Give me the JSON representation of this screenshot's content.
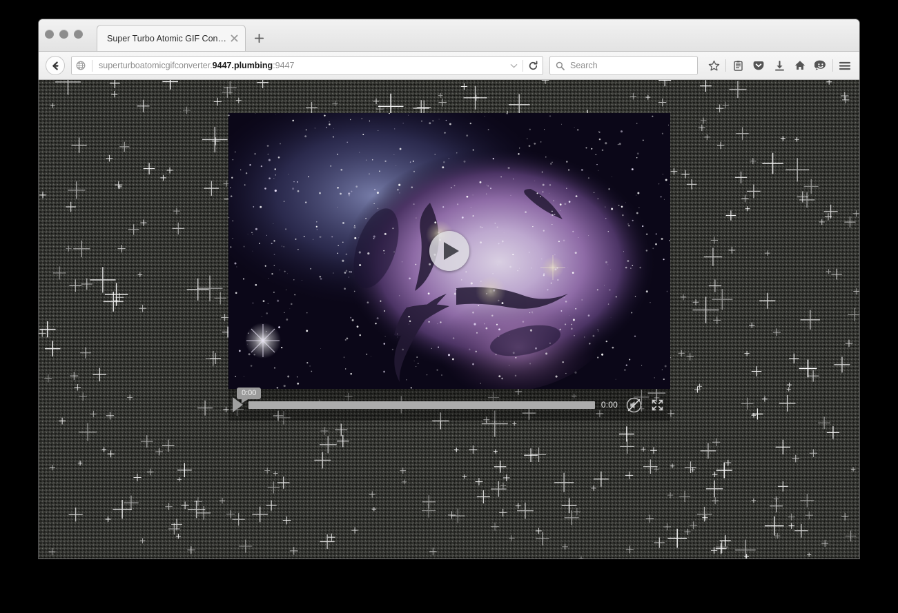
{
  "window": {
    "traffic_lights": [
      "close",
      "minimize",
      "zoom"
    ]
  },
  "tabs": {
    "active_title": "Super Turbo Atomic GIF Conver…",
    "close_label": "✖",
    "new_tab_label": "+"
  },
  "navbar": {
    "back_icon": "back-arrow-icon",
    "identity_icon": "globe-icon",
    "url_prefix": "superturboatomicgifconverter.",
    "url_host": "9447.plumbing",
    "url_suffix": ":9447",
    "dropdown_icon": "chevron-down-icon",
    "reload_icon": "reload-icon",
    "search_placeholder": "Search",
    "search_value": "",
    "toolbar_icons": [
      "bookmark-star-icon",
      "reader-list-icon",
      "pocket-icon",
      "downloads-icon",
      "home-icon",
      "sync-smiley-icon",
      "hamburger-menu-icon"
    ]
  },
  "page": {
    "background_color": "#3b3d34",
    "star_color": "#ffffff"
  },
  "video": {
    "poster_description": "Trifid Nebula — purple nebula with stars",
    "big_play_icon": "play-icon",
    "controls": {
      "play_icon": "play-icon",
      "tooltip_time": "0:00",
      "progress_percent": 0,
      "current_time": "0:00",
      "mute_icon": "volume-muted-icon",
      "fullscreen_icon": "fullscreen-icon"
    }
  },
  "colors": {
    "chrome_top": "#f2f2f2",
    "chrome_bottom": "#e3e3e3",
    "url_host_text": "#1a1a1a",
    "url_dim_text": "#8d8d8d",
    "control_bar": "rgba(0,0,0,0.30)",
    "scrubber": "#acacac",
    "tooltip_bg": "#9b9b9b"
  }
}
